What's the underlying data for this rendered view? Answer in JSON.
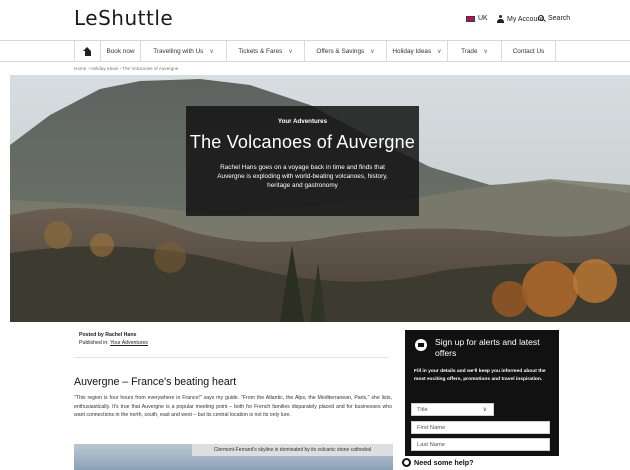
{
  "header": {
    "logo_text": "LeShuttle",
    "locale": "UK",
    "my_account": "My Account",
    "search": "Search"
  },
  "nav": {
    "items": [
      {
        "label": "Book now"
      },
      {
        "label": "Travelling with Us"
      },
      {
        "label": "Tickets & Fares"
      },
      {
        "label": "Offers & Savings"
      },
      {
        "label": "Holiday Ideas"
      },
      {
        "label": "Trade"
      },
      {
        "label": "Contact Us"
      }
    ]
  },
  "breadcrumb": "Home › Holiday Ideas › The Volcanoes of Auvergne",
  "hero": {
    "kicker": "Your Adventures",
    "title": "The Volcanoes of Auvergne",
    "subtitle": "Rachel Hans goes on a voyage back in time and finds that Auvergne is exploding with world-beating volcanoes, history, heritage and gastronomy"
  },
  "article": {
    "posted_by": "Posted by Rachel Hans",
    "published_in_prefix": "Published in:",
    "published_in_link": "Your Adventures",
    "title": "Auvergne – France's beating heart",
    "body": "\"This region is four hours from everywhere in France!\" says my guide. \"From the Atlantic, the Alps, the Mediterranean, Paris,\" she lists, enthusiastically. It's true that Auvergne is a popular meeting point – both for French families disparately placed and for businesses who want connections in the north, south, east and west – but its central location is not its only lure.",
    "image_caption": "Clermont-Ferrand's skyline is dominated by its volcanic stone cathedral"
  },
  "signup": {
    "title": "Sign up for alerts and latest offers",
    "text": "Fill in your details and we'll keep you informed about the most exciting offers, promotions and travel inspiration.",
    "title_field": "Title",
    "first_name_placeholder": "First Name",
    "last_name_placeholder": "Last Name"
  },
  "help": "Need some help?"
}
